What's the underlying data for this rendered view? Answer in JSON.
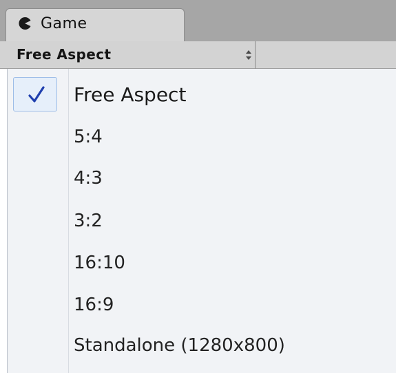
{
  "tab": {
    "label": "Game",
    "icon": "pacman-icon"
  },
  "toolbar": {
    "aspect_dropdown": {
      "selected": "Free Aspect",
      "icon": "up-down-arrows-icon"
    }
  },
  "menu": {
    "selected_index": 0,
    "items": [
      {
        "label": "Free Aspect"
      },
      {
        "label": "5:4"
      },
      {
        "label": "4:3"
      },
      {
        "label": "3:2"
      },
      {
        "label": "16:10"
      },
      {
        "label": "16:9"
      },
      {
        "label": "Standalone (1280x800)"
      }
    ]
  },
  "colors": {
    "check": "#1f3fae",
    "selection_bg": "#e6effa",
    "selection_border": "#9dbde7"
  }
}
